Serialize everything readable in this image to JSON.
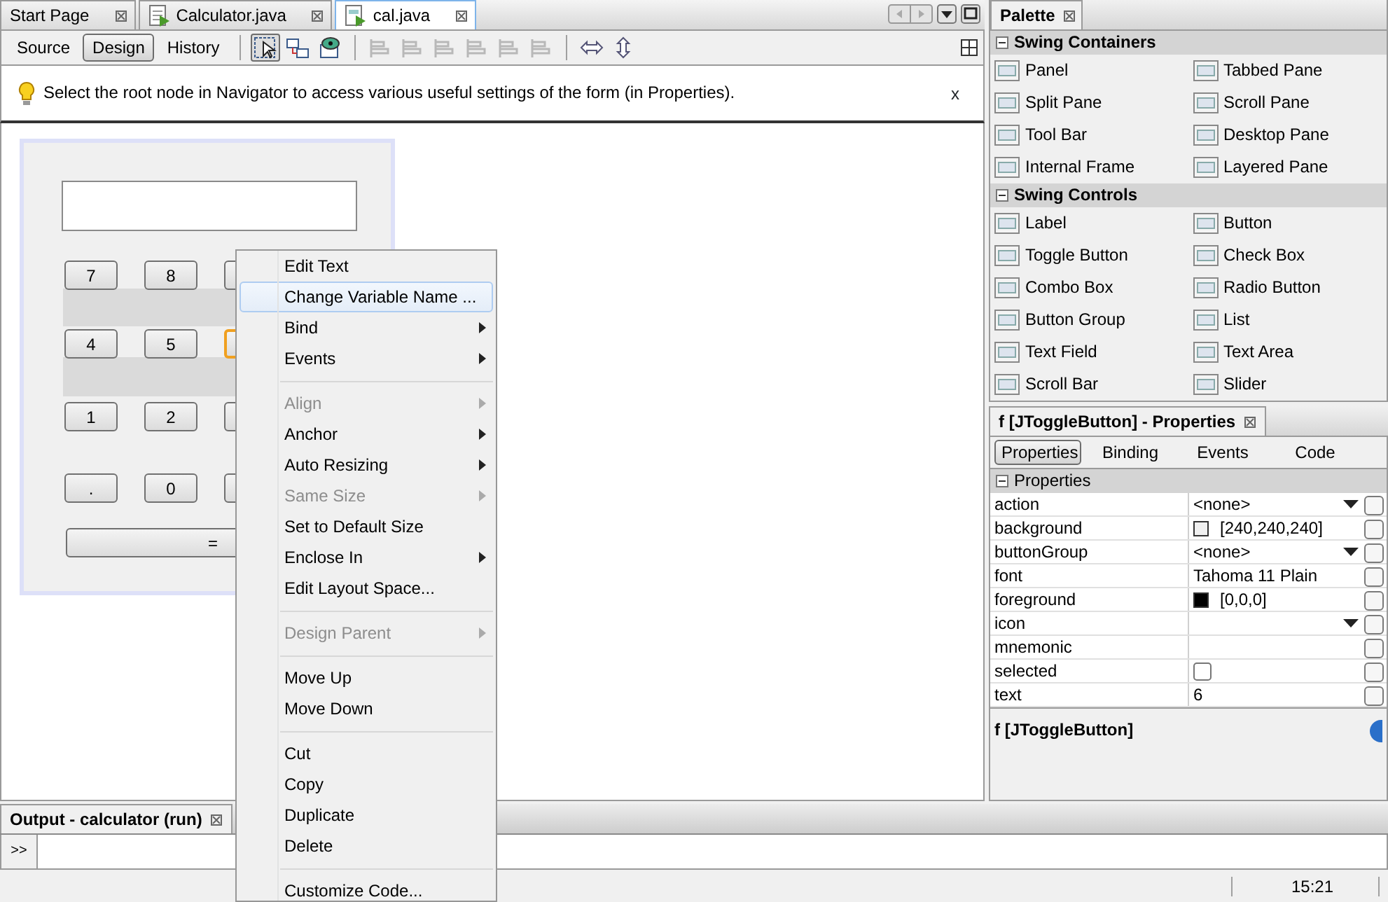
{
  "editor_tabs": [
    {
      "label": "Start Page",
      "kind": "plain",
      "selected": false
    },
    {
      "label": "Calculator.java",
      "kind": "java",
      "selected": false
    },
    {
      "label": "cal.java",
      "kind": "form",
      "selected": true
    }
  ],
  "editor_toolbar": {
    "views": [
      {
        "label": "Source",
        "selected": false
      },
      {
        "label": "Design",
        "selected": true
      },
      {
        "label": "History",
        "selected": false
      }
    ],
    "tools": [
      {
        "kind": "selection",
        "selected": true,
        "disabled": false
      },
      {
        "kind": "connection",
        "selected": false,
        "disabled": false
      },
      {
        "kind": "preview",
        "selected": false,
        "disabled": false
      },
      {
        "kind": "align",
        "selected": false,
        "disabled": true
      },
      {
        "kind": "align",
        "selected": false,
        "disabled": true
      },
      {
        "kind": "align",
        "selected": false,
        "disabled": true
      },
      {
        "kind": "align",
        "selected": false,
        "disabled": true
      },
      {
        "kind": "align",
        "selected": false,
        "disabled": true
      },
      {
        "kind": "align",
        "selected": false,
        "disabled": true
      },
      {
        "kind": "resize-horizontal",
        "selected": false,
        "disabled": false
      },
      {
        "kind": "resize-vertical",
        "selected": false,
        "disabled": false
      }
    ]
  },
  "hint": {
    "text": "Select the root node in Navigator to access various useful settings of the form (in Properties).",
    "close": "x"
  },
  "form": {
    "keypad": [
      [
        {
          "label": "7",
          "selected": false
        },
        {
          "label": "8",
          "selected": false
        },
        {
          "selected": false
        }
      ],
      [
        {
          "label": "4",
          "selected": false
        },
        {
          "label": "5",
          "selected": false
        },
        {
          "selected": true
        }
      ],
      [
        {
          "label": "1",
          "selected": false
        },
        {
          "label": "2",
          "selected": false
        },
        {
          "selected": false
        }
      ],
      [
        {
          "label": ".",
          "selected": false
        },
        {
          "label": "0",
          "selected": false
        },
        {
          "selected": false
        }
      ]
    ],
    "equals": "="
  },
  "context_menu": [
    {
      "kind": "item",
      "label": "Edit Text",
      "disabled": false,
      "submenu": false,
      "selected": false
    },
    {
      "kind": "item",
      "label": "Change Variable Name ...",
      "disabled": false,
      "submenu": false,
      "selected": true
    },
    {
      "kind": "item",
      "label": "Bind",
      "disabled": false,
      "submenu": true,
      "selected": false
    },
    {
      "kind": "item",
      "label": "Events",
      "disabled": false,
      "submenu": true,
      "selected": false
    },
    {
      "kind": "separator"
    },
    {
      "kind": "item",
      "label": "Align",
      "disabled": true,
      "submenu": true,
      "selected": false
    },
    {
      "kind": "item",
      "label": "Anchor",
      "disabled": false,
      "submenu": true,
      "selected": false
    },
    {
      "kind": "item",
      "label": "Auto Resizing",
      "disabled": false,
      "submenu": true,
      "selected": false
    },
    {
      "kind": "item",
      "label": "Same Size",
      "disabled": true,
      "submenu": true,
      "selected": false
    },
    {
      "kind": "item",
      "label": "Set to Default Size",
      "disabled": false,
      "submenu": false,
      "selected": false
    },
    {
      "kind": "item",
      "label": "Enclose In",
      "disabled": false,
      "submenu": true,
      "selected": false
    },
    {
      "kind": "item",
      "label": "Edit Layout Space...",
      "disabled": false,
      "submenu": false,
      "selected": false
    },
    {
      "kind": "separator"
    },
    {
      "kind": "item",
      "label": "Design Parent",
      "disabled": true,
      "submenu": true,
      "selected": false
    },
    {
      "kind": "separator"
    },
    {
      "kind": "item",
      "label": "Move Up",
      "disabled": false,
      "submenu": false,
      "selected": false
    },
    {
      "kind": "item",
      "label": "Move Down",
      "disabled": false,
      "submenu": false,
      "selected": false
    },
    {
      "kind": "separator"
    },
    {
      "kind": "item",
      "label": "Cut",
      "disabled": false,
      "submenu": false,
      "selected": false
    },
    {
      "kind": "item",
      "label": "Copy",
      "disabled": false,
      "submenu": false,
      "selected": false
    },
    {
      "kind": "item",
      "label": "Duplicate",
      "disabled": false,
      "submenu": false,
      "selected": false
    },
    {
      "kind": "item",
      "label": "Delete",
      "disabled": false,
      "submenu": false,
      "selected": false
    },
    {
      "kind": "separator"
    },
    {
      "kind": "item",
      "label": "Customize Code...",
      "disabled": false,
      "submenu": false,
      "selected": false
    }
  ],
  "palette": {
    "title": "Palette",
    "sections": [
      {
        "title": "Swing Containers",
        "expanded": true,
        "items": [
          "Panel",
          "Tabbed Pane",
          "Split Pane",
          "Scroll Pane",
          "Tool Bar",
          "Desktop Pane",
          "Internal Frame",
          "Layered Pane"
        ]
      },
      {
        "title": "Swing Controls",
        "expanded": true,
        "items": [
          "Label",
          "Button",
          "Toggle Button",
          "Check Box",
          "Combo Box",
          "Radio Button",
          "Button Group",
          "List",
          "Text Field",
          "Text Area",
          "Scroll Bar",
          "Slider"
        ]
      }
    ]
  },
  "properties": {
    "title": "f [JToggleButton] - Properties",
    "tabs": [
      {
        "label": "Properties",
        "selected": true
      },
      {
        "label": "Binding",
        "selected": false
      },
      {
        "label": "Events",
        "selected": false
      },
      {
        "label": "Code",
        "selected": false
      }
    ],
    "section": {
      "title": "Properties",
      "expanded": true
    },
    "rows": [
      {
        "name": "action",
        "kind": "dropdown",
        "value": "<none>"
      },
      {
        "name": "background",
        "kind": "color",
        "value": "[240,240,240]",
        "color": "#f0f0f0"
      },
      {
        "name": "buttonGroup",
        "kind": "dropdown",
        "value": "<none>"
      },
      {
        "name": "font",
        "kind": "text",
        "value": "Tahoma 11 Plain"
      },
      {
        "name": "foreground",
        "kind": "color",
        "value": "[0,0,0]",
        "color": "#000000"
      },
      {
        "name": "icon",
        "kind": "dropdown"
      },
      {
        "name": "mnemonic",
        "kind": "text"
      },
      {
        "name": "selected",
        "kind": "checkbox",
        "checked": false
      },
      {
        "name": "text",
        "kind": "text",
        "value": "6"
      }
    ],
    "description": "f [JToggleButton]"
  },
  "output": {
    "title": "Output - calculator (run)",
    "button": ">>"
  },
  "status_bar": {
    "time": "15:21"
  }
}
